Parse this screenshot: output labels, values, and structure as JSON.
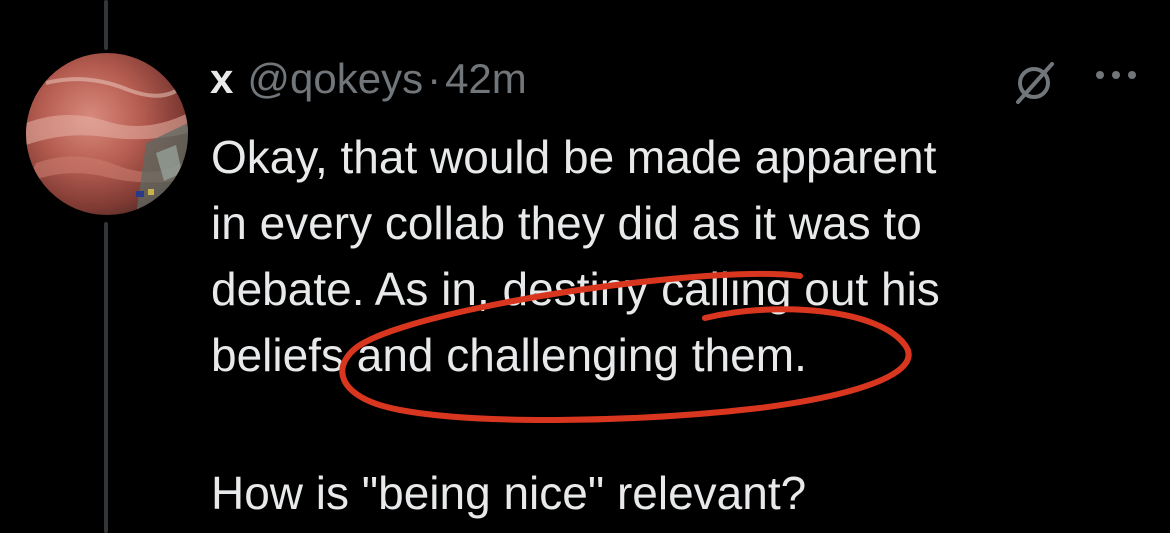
{
  "tweet": {
    "display_name": "x",
    "handle": "@qokeys",
    "separator": "·",
    "time": "42m",
    "text_lines": [
      "Okay, that would be made apparent",
      "in every collab they did as it was to",
      "debate. As in, destiny calling out his",
      "beliefs and challenging them."
    ],
    "text_last": "How is \"being nice\" relevant?"
  },
  "icons": {
    "grok": "grok-icon",
    "more": "more-options-icon",
    "avatar": "avatar-image"
  },
  "colors": {
    "background": "#000000",
    "primary_text": "#e7e9ea",
    "secondary_text": "#71767b",
    "thread_line": "#333639",
    "annotation": "#d9361f"
  }
}
